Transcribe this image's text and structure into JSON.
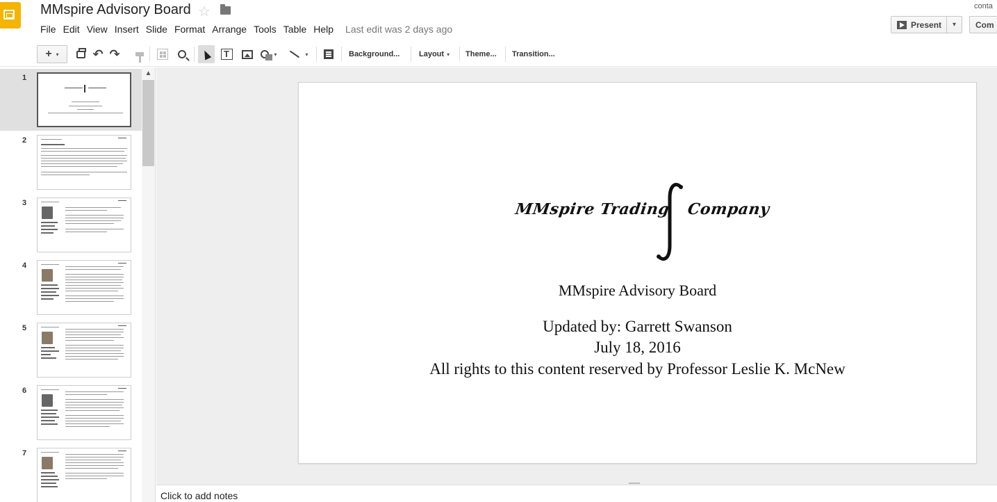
{
  "header": {
    "doc_title": "MMspire Advisory Board",
    "menus": [
      "File",
      "Edit",
      "View",
      "Insert",
      "Slide",
      "Format",
      "Arrange",
      "Tools",
      "Table",
      "Help"
    ],
    "last_edit": "Last edit was 2 days ago",
    "user_email_partial": "conta",
    "present_label": "Present",
    "comments_label": "Com"
  },
  "toolbar": {
    "new_slide_label": "+",
    "background_label": "Background...",
    "layout_label": "Layout",
    "theme_label": "Theme...",
    "transition_label": "Transition..."
  },
  "filmstrip": {
    "slides": [
      {
        "number": "1",
        "selected": true
      },
      {
        "number": "2",
        "selected": false
      },
      {
        "number": "3",
        "selected": false
      },
      {
        "number": "4",
        "selected": false
      },
      {
        "number": "5",
        "selected": false
      },
      {
        "number": "6",
        "selected": false
      },
      {
        "number": "7",
        "selected": false
      }
    ]
  },
  "slide": {
    "logo_left": "MMspire Trading",
    "logo_right": "Company",
    "title": "MMspire Advisory Board",
    "updated_by": "Updated by: Garrett Swanson",
    "date": "July 18, 2016",
    "rights": "All rights to this content reserved by Professor Leslie K. McNew"
  },
  "notes": {
    "placeholder": "Click to add notes"
  }
}
